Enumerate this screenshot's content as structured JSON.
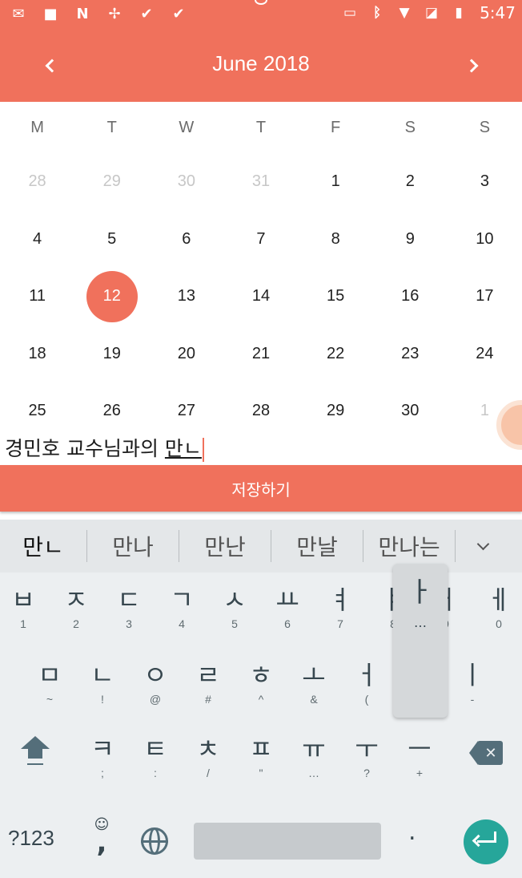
{
  "status_bar": {
    "left_icons": [
      "gmail-icon",
      "video-icon",
      "n-app-icon",
      "pinwheel-icon",
      "check-app-icon",
      "check-app-icon-2"
    ],
    "right_icons": [
      "cast-icon",
      "bluetooth-icon",
      "wifi-icon",
      "no-sim-icon",
      "battery-charging-icon"
    ],
    "time": "5:47"
  },
  "header": {
    "month_title": "June  2018",
    "prev_icon": "chevron-left-icon",
    "next_icon": "chevron-right-icon",
    "background": "#f0715c"
  },
  "calendar": {
    "weekdays": [
      "M",
      "T",
      "W",
      "T",
      "F",
      "S",
      "S"
    ],
    "weeks": [
      [
        "28",
        "29",
        "30",
        "31",
        "1",
        "2",
        "3"
      ],
      [
        "4",
        "5",
        "6",
        "7",
        "8",
        "9",
        "10"
      ],
      [
        "11",
        "12",
        "13",
        "14",
        "15",
        "16",
        "17"
      ],
      [
        "18",
        "19",
        "20",
        "21",
        "22",
        "23",
        "24"
      ],
      [
        "25",
        "26",
        "27",
        "28",
        "29",
        "30",
        "1"
      ]
    ],
    "other_month_cells": [
      [
        0,
        0
      ],
      [
        0,
        1
      ],
      [
        0,
        2
      ],
      [
        0,
        3
      ],
      [
        4,
        6
      ]
    ],
    "selected_day": "12",
    "accent": "#f0715c"
  },
  "memo": {
    "text_committed": "경민호 교수님과의 ",
    "text_composing": "만ㄴ"
  },
  "save_button": {
    "label": "저장하기"
  },
  "keyboard": {
    "suggestions": [
      "만ㄴ",
      "만나",
      "만난",
      "만날",
      "만나는"
    ],
    "row1": [
      {
        "main": "ㅂ",
        "hint": "1"
      },
      {
        "main": "ㅈ",
        "hint": "2"
      },
      {
        "main": "ㄷ",
        "hint": "3"
      },
      {
        "main": "ㄱ",
        "hint": "4"
      },
      {
        "main": "ㅅ",
        "hint": "5"
      },
      {
        "main": "ㅛ",
        "hint": "6"
      },
      {
        "main": "ㅕ",
        "hint": "7"
      },
      {
        "main": "ㅑ",
        "hint": "8"
      },
      {
        "main": "ㅐ",
        "hint": "9"
      },
      {
        "main": "ㅔ",
        "hint": "0"
      }
    ],
    "row2": [
      {
        "main": "ㅁ",
        "hint": "~"
      },
      {
        "main": "ㄴ",
        "hint": "!"
      },
      {
        "main": "ㅇ",
        "hint": "@"
      },
      {
        "main": "ㄹ",
        "hint": "#"
      },
      {
        "main": "ㅎ",
        "hint": "^"
      },
      {
        "main": "ㅗ",
        "hint": "&"
      },
      {
        "main": "ㅓ",
        "hint": "("
      },
      {
        "main": "ㅏ",
        "hint": ")"
      },
      {
        "main": "ㅣ",
        "hint": "-"
      }
    ],
    "row3": [
      {
        "main": "ㅋ",
        "hint": ";"
      },
      {
        "main": "ㅌ",
        "hint": ":"
      },
      {
        "main": "ㅊ",
        "hint": "/"
      },
      {
        "main": "ㅍ",
        "hint": "\""
      },
      {
        "main": "ㅠ",
        "hint": "…"
      },
      {
        "main": "ㅜ",
        "hint": "?"
      },
      {
        "main": "ㅡ",
        "hint": "+"
      }
    ],
    "popup": {
      "main": "ㅏ",
      "hint": "…"
    },
    "symbols_key": "?123",
    "emoji_comma": {
      "top": "☺",
      "main": ","
    },
    "period_key": ".",
    "enter_color": "#26a69a"
  }
}
